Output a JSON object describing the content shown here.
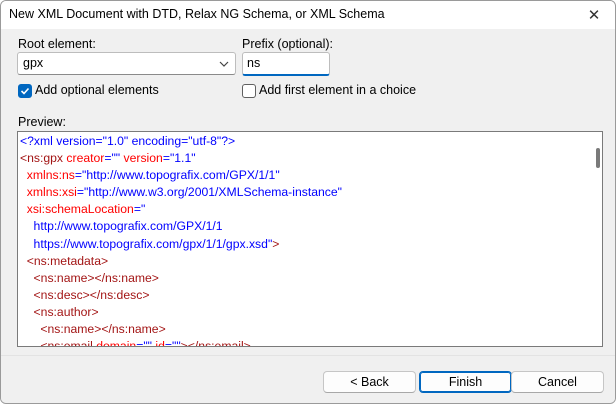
{
  "window": {
    "title": "New XML Document with DTD, Relax NG Schema, or XML Schema",
    "close_glyph": "✕"
  },
  "root_element": {
    "label": "Root element:",
    "value": "gpx"
  },
  "prefix": {
    "label": "Prefix (optional):",
    "value": "ns"
  },
  "options": {
    "add_optional": {
      "label": "Add optional elements",
      "checked": true
    },
    "add_first_choice": {
      "label": "Add first element in a choice",
      "checked": false
    }
  },
  "preview": {
    "label": "Preview:",
    "lines": [
      "<?xml version=\"1.0\" encoding=\"utf-8\"?>",
      "<ns:gpx creator=\"\" version=\"1.1\"",
      "  xmlns:ns=\"http://www.topografix.com/GPX/1/1\"",
      "  xmlns:xsi=\"http://www.w3.org/2001/XMLSchema-instance\"",
      "  xsi:schemaLocation=\"",
      "    http://www.topografix.com/GPX/1/1",
      "    https://www.topografix.com/gpx/1/1/gpx.xsd\">",
      "  <ns:metadata>",
      "    <ns:name></ns:name>",
      "    <ns:desc></ns:desc>",
      "    <ns:author>",
      "      <ns:name></ns:name>",
      "      <ns:email domain=\"\" id=\"\"></ns:email>"
    ]
  },
  "buttons": {
    "back": "< Back",
    "finish": "Finish",
    "cancel": "Cancel"
  },
  "colors": {
    "accent": "#0067c0",
    "tag": "#a31515",
    "attr": "#ff0000",
    "value": "#0000ff"
  }
}
